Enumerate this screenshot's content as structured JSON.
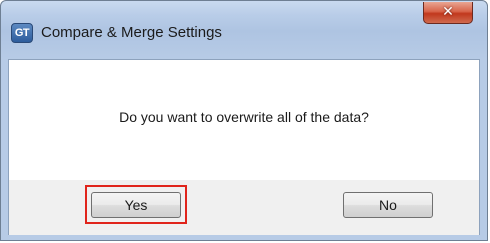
{
  "window": {
    "title": "Compare & Merge Settings",
    "app_icon_text": "GT",
    "close_glyph": "✕"
  },
  "dialog": {
    "message": "Do you want to overwrite all of the data?"
  },
  "buttons": {
    "yes_label": "Yes",
    "no_label": "No"
  },
  "annotation": {
    "highlight_color": "#e0241b"
  }
}
